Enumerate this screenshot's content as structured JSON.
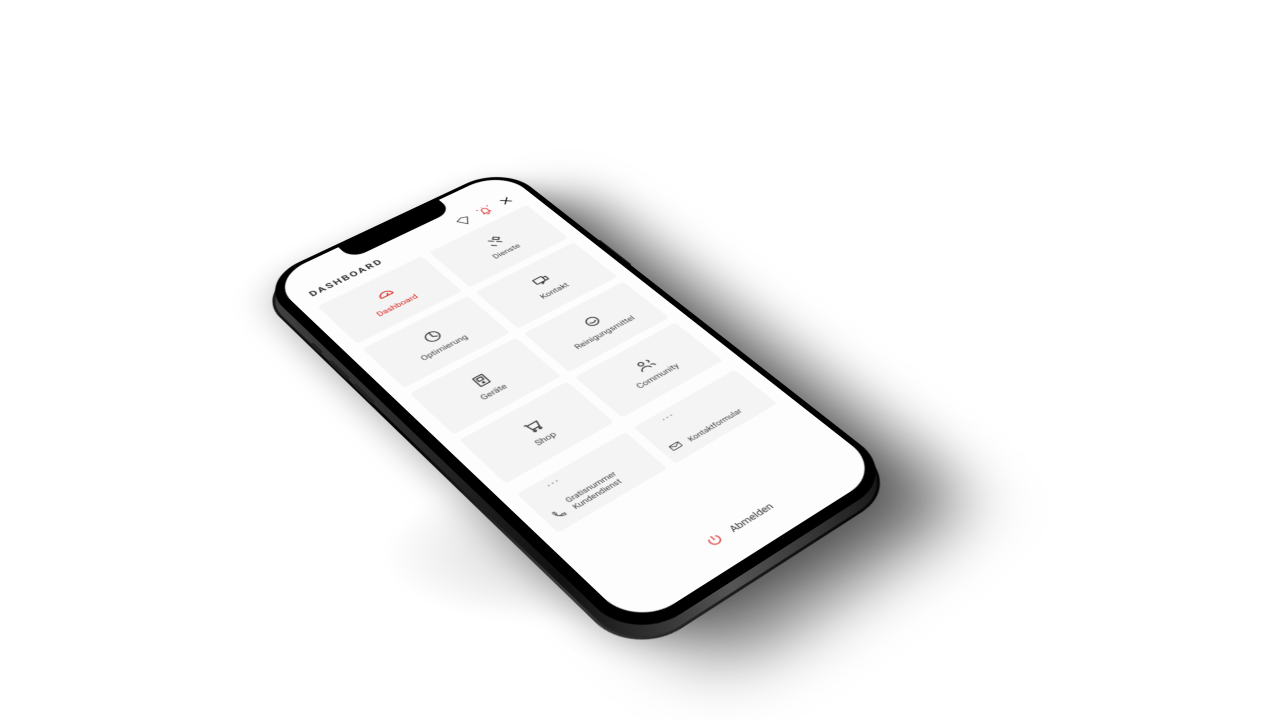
{
  "header": {
    "title": "DASHBOARD"
  },
  "tiles": [
    {
      "label": "Dashboard",
      "icon": "dashboard",
      "active": true
    },
    {
      "label": "Dienste",
      "icon": "services"
    },
    {
      "label": "Optimierung",
      "icon": "optimize"
    },
    {
      "label": "Kontakt",
      "icon": "contact"
    },
    {
      "label": "Geräte",
      "icon": "device"
    },
    {
      "label": "Reinigungsmittel",
      "icon": "cleaning"
    },
    {
      "label": "Shop",
      "icon": "shop"
    },
    {
      "label": "Community",
      "icon": "community"
    }
  ],
  "cards": {
    "left": {
      "line1": "Gratisnummer",
      "line2": "Kundendienst"
    },
    "right": {
      "line1": "Kontaktformular"
    }
  },
  "logout": {
    "label": "Abmelden"
  }
}
